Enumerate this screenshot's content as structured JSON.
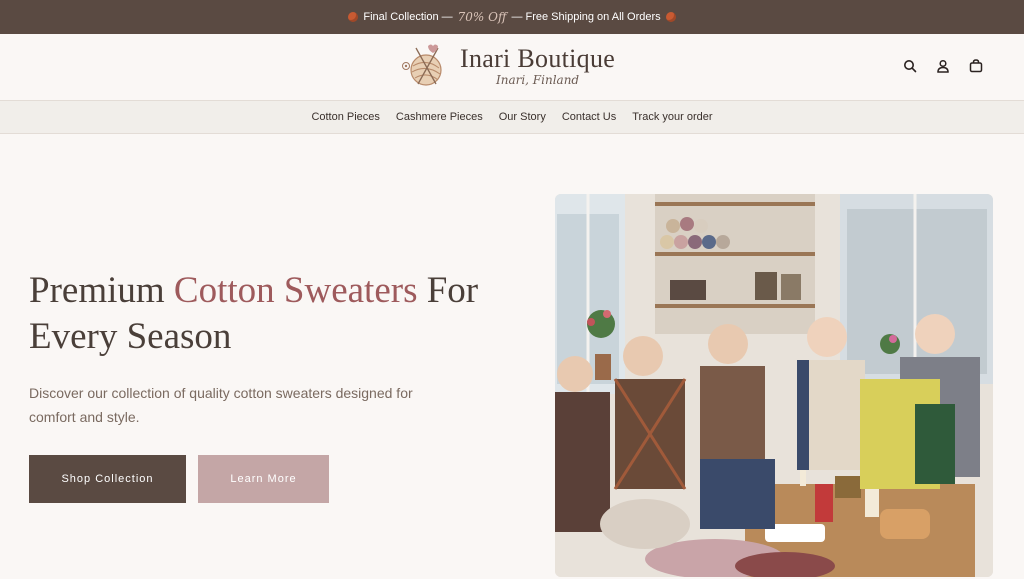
{
  "announcement": {
    "part1": "Final Collection —",
    "accent": "70% Off",
    "part2": "— Free Shipping on All Orders"
  },
  "brand": {
    "name": "Inari Boutique",
    "location": "Inari, Finland"
  },
  "header_icons": [
    "search-icon",
    "account-icon",
    "bag-icon"
  ],
  "nav": {
    "items": [
      {
        "label": "Cotton Pieces"
      },
      {
        "label": "Cashmere Pieces"
      },
      {
        "label": "Our Story"
      },
      {
        "label": "Contact Us"
      },
      {
        "label": "Track your order"
      }
    ]
  },
  "hero": {
    "headline_pre": "Premium ",
    "headline_accent": "Cotton Sweaters",
    "headline_post": " For Every Season",
    "description": "Discover our collection of quality cotton sweaters designed for comfort and style.",
    "primary_button": "Shop Collection",
    "secondary_button": "Learn More"
  },
  "colors": {
    "announcement_bg": "#5a4a42",
    "accent": "#9e5a5c",
    "primary_button": "#5a4a42",
    "secondary_button": "#c4a6a6"
  }
}
